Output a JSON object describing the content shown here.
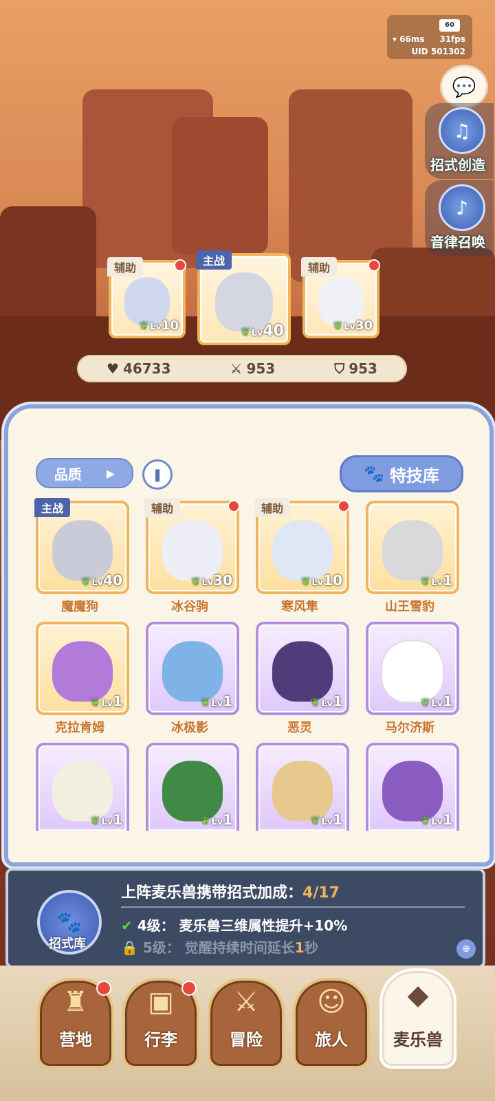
{
  "status": {
    "battery": "60",
    "ping": "66ms",
    "fps": "31fps",
    "uid": "UID 501302"
  },
  "side_buttons": [
    {
      "label": "招式创造",
      "icon": "book-music-icon"
    },
    {
      "label": "音律召唤",
      "icon": "lyre-icon"
    }
  ],
  "team": [
    {
      "tag": "辅助",
      "level": "10",
      "dot": true,
      "color": "#cfd8ee"
    },
    {
      "tag": "主战",
      "level": "40",
      "dot": false,
      "color": "#d4d6e0"
    },
    {
      "tag": "辅助",
      "level": "30",
      "dot": true,
      "color": "#f0f0f7"
    }
  ],
  "stats": {
    "hp": "46733",
    "attack": "953",
    "defense": "953"
  },
  "panel": {
    "quality_label": "品质",
    "skill_library_label": "特技库",
    "pets": [
      {
        "name": "魔魔狗",
        "tag": "主战",
        "level": "40",
        "dot": false,
        "frame": "gold",
        "color": "#c9cbd8"
      },
      {
        "name": "冰谷驹",
        "tag": "辅助",
        "level": "30",
        "dot": true,
        "frame": "gold",
        "color": "#eeeef6"
      },
      {
        "name": "寒风隼",
        "tag": "辅助",
        "level": "10",
        "dot": true,
        "frame": "gold",
        "color": "#dfe6f5"
      },
      {
        "name": "山王雪豹",
        "tag": "",
        "level": "1",
        "dot": false,
        "frame": "gold",
        "color": "#d9d9dc"
      },
      {
        "name": "克拉肯姆",
        "tag": "",
        "level": "1",
        "dot": false,
        "frame": "gold",
        "color": "#b27ad9"
      },
      {
        "name": "冰极影",
        "tag": "",
        "level": "1",
        "dot": false,
        "frame": "purple",
        "color": "#7fb3e8"
      },
      {
        "name": "恶灵",
        "tag": "",
        "level": "1",
        "dot": false,
        "frame": "purple",
        "color": "#4e3d7a"
      },
      {
        "name": "马尔济斯",
        "tag": "",
        "level": "1",
        "dot": false,
        "frame": "purple",
        "color": "#ffffff"
      },
      {
        "name": "",
        "tag": "",
        "level": "1",
        "dot": false,
        "frame": "purple",
        "color": "#f1efe0"
      },
      {
        "name": "",
        "tag": "",
        "level": "1",
        "dot": false,
        "frame": "purple",
        "color": "#3f8a45"
      },
      {
        "name": "",
        "tag": "",
        "level": "1",
        "dot": false,
        "frame": "purple",
        "color": "#e8c98d"
      },
      {
        "name": "",
        "tag": "",
        "level": "1",
        "dot": false,
        "frame": "purple",
        "color": "#8a5cc0"
      }
    ]
  },
  "bonus": {
    "title": "上阵麦乐兽携带招式加成：",
    "count": "4/17",
    "library_label": "招式库",
    "row1": "4级：  麦乐兽三维属性提升+10%",
    "row2_prefix": "5级：  觉醒持续时间延长",
    "row2_num": "1",
    "row2_suffix": "秒"
  },
  "nav": [
    {
      "label": "营地",
      "icon": "castle-icon",
      "dot": true,
      "active": false
    },
    {
      "label": "行李",
      "icon": "bag-icon",
      "dot": true,
      "active": false
    },
    {
      "label": "冒险",
      "icon": "swords-icon",
      "dot": false,
      "active": false
    },
    {
      "label": "旅人",
      "icon": "traveler-icon",
      "dot": false,
      "active": false
    },
    {
      "label": "麦乐兽",
      "icon": "fox-icon",
      "dot": false,
      "active": true
    }
  ]
}
